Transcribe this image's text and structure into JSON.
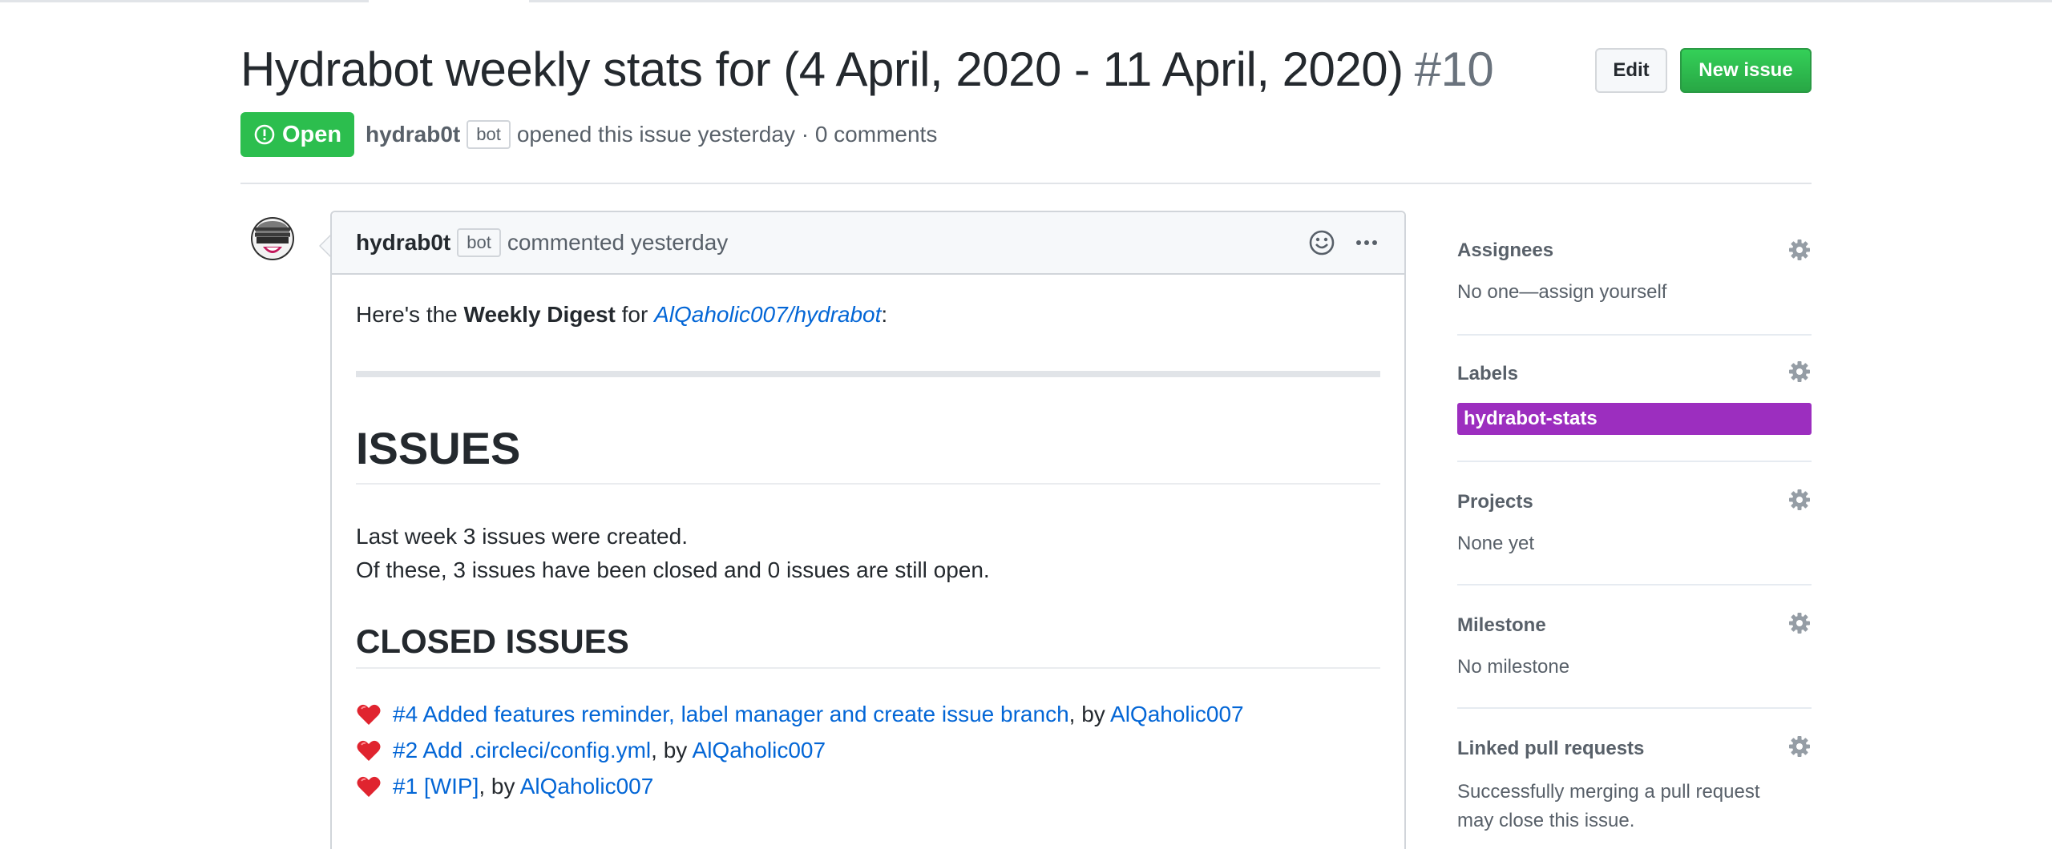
{
  "issue": {
    "title": "Hydrabot weekly stats for (4 April, 2020 - 11 April, 2020)",
    "number": "#10",
    "state": "Open",
    "author": "hydrab0t",
    "bot_badge": "bot",
    "opened_text": "opened this issue yesterday · 0 comments"
  },
  "header_buttons": {
    "edit": "Edit",
    "new_issue": "New issue"
  },
  "comment": {
    "author": "hydrab0t",
    "bot_badge": "bot",
    "action": "commented yesterday",
    "intro_prefix": "Here's the ",
    "intro_bold": "Weekly Digest",
    "intro_mid": " for ",
    "intro_repo": "AlQaholic007/hydrabot",
    "intro_suffix": ":",
    "h1": "ISSUES",
    "p_line1": "Last week 3 issues were created.",
    "p_line2": "Of these, 3 issues have been closed and 0 issues are still open.",
    "h2": "CLOSED ISSUES",
    "closed_issues": [
      {
        "link": "#4 Added features reminder, label manager and create issue branch",
        "by": ", by ",
        "user": "AlQaholic007"
      },
      {
        "link": "#2 Add .circleci/config.yml",
        "by": ", by ",
        "user": "AlQaholic007"
      },
      {
        "link": "#1 [WIP]",
        "by": ", by ",
        "user": "AlQaholic007"
      }
    ]
  },
  "sidebar": {
    "assignees": {
      "title": "Assignees",
      "value": "No one—assign yourself"
    },
    "labels": {
      "title": "Labels",
      "label": "hydrabot-stats",
      "label_color": "#9c2ebf"
    },
    "projects": {
      "title": "Projects",
      "value": "None yet"
    },
    "milestone": {
      "title": "Milestone",
      "value": "No milestone"
    },
    "linked": {
      "title": "Linked pull requests",
      "value_line1": "Successfully merging a pull request",
      "value_line2": "may close this issue."
    }
  },
  "colors": {
    "open_green": "#2cbe4e",
    "link_blue": "#0366d6",
    "new_issue_green": "#28a745"
  },
  "icons": [
    "issue-opened-icon",
    "smiley-icon",
    "kebab-horizontal-icon",
    "heart-icon",
    "gear-icon"
  ]
}
